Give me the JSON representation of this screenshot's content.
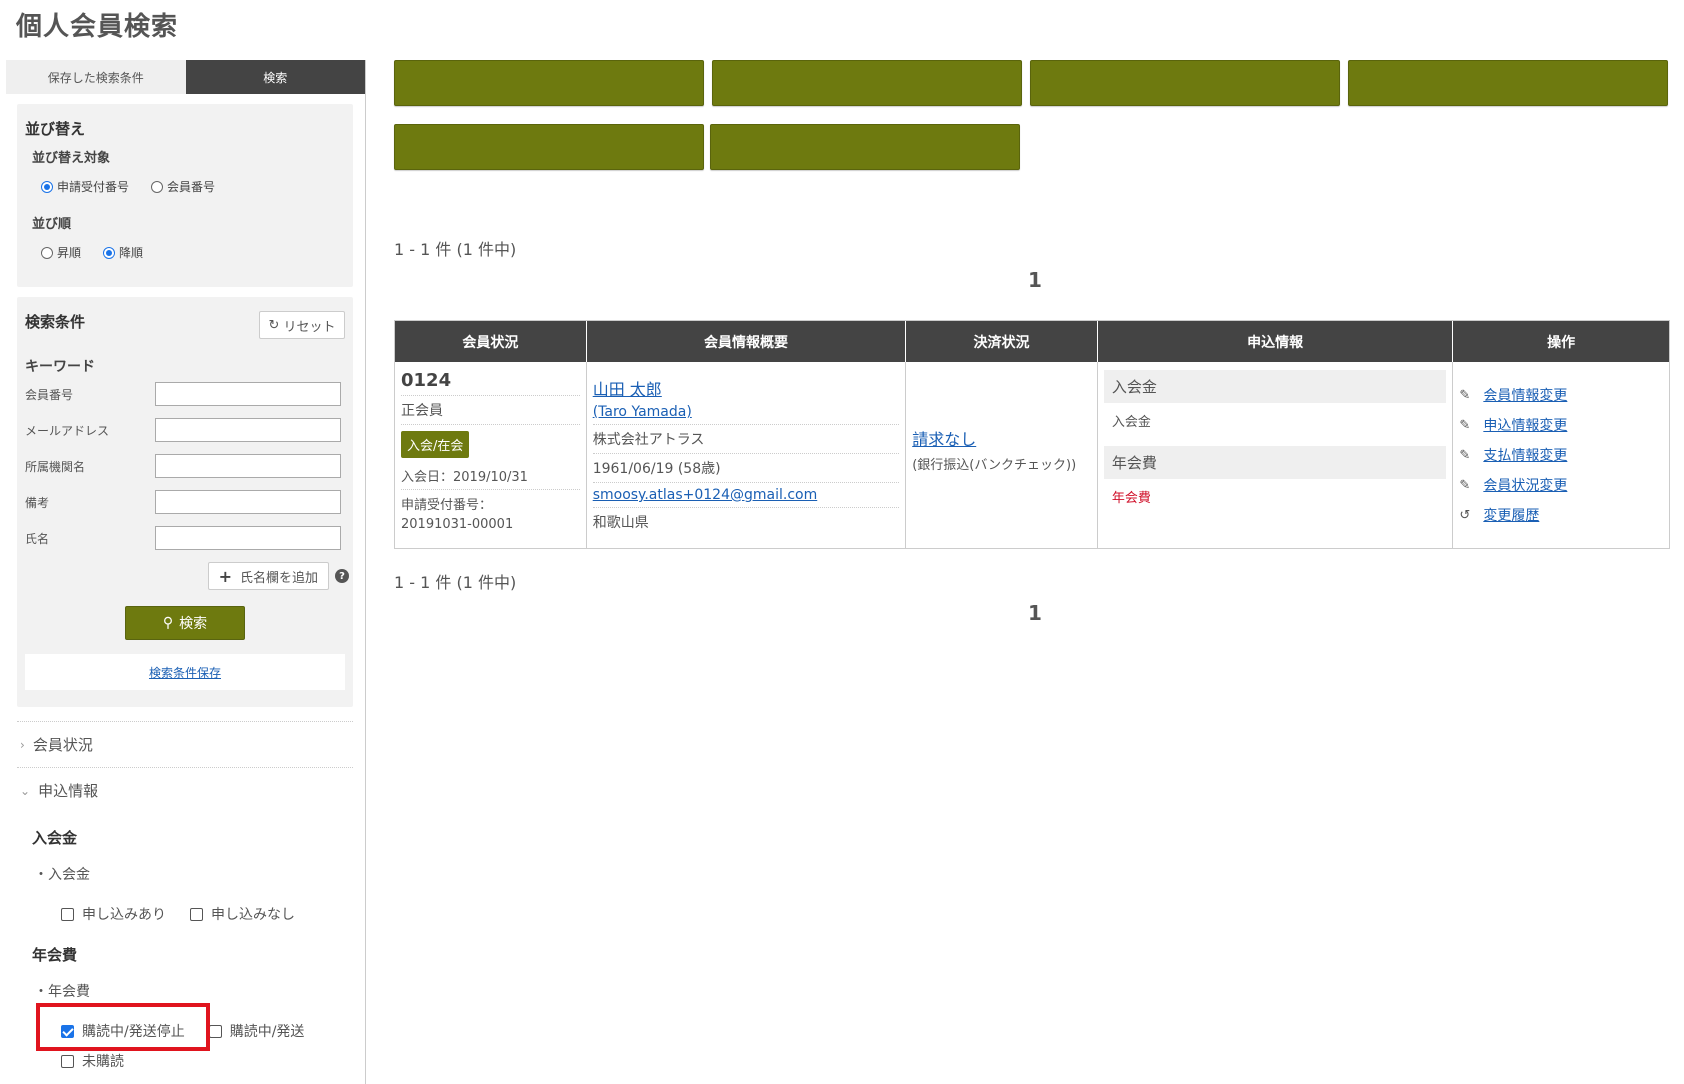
{
  "page": {
    "title": "個人会員検索"
  },
  "sidebar": {
    "tabs": [
      "保存した検索条件",
      "検索"
    ],
    "sort": {
      "title": "並び替え",
      "target_label": "並び替え対象",
      "target_options": [
        "申請受付番号",
        "会員番号"
      ],
      "order_label": "並び順",
      "order_options": [
        "昇順",
        "降順"
      ]
    },
    "conditions": {
      "title": "検索条件",
      "reset_label": "リセット",
      "keyword_label": "キーワード",
      "fields": [
        "会員番号",
        "メールアドレス",
        "所属機関名",
        "備考",
        "氏名"
      ],
      "add_name_label": "氏名欄を追加",
      "search_label": "検索",
      "save_link": "検索条件保存"
    },
    "accordions": {
      "member_status": "会員状況",
      "application": "申込情報"
    },
    "groups": {
      "entry_fee": {
        "title": "入会金",
        "bullet": "・入会金",
        "options": [
          "申し込みあり",
          "申し込みなし"
        ]
      },
      "annual_fee": {
        "title": "年会費",
        "bullet": "・年会費",
        "options": [
          "購読中/発送停止",
          "購読中/発送",
          "未購読"
        ]
      }
    }
  },
  "main": {
    "count_text": "1 - 1 件 (1 件中)",
    "page_number": "1",
    "table": {
      "headers": [
        "会員状況",
        "会員情報概要",
        "決済状況",
        "申込情報",
        "操作"
      ],
      "row": {
        "member_no": "0124",
        "member_type": "正会員",
        "status_badge": "入会/在会",
        "join_date": "入会日：2019/10/31",
        "app_no_label": "申請受付番号：",
        "app_no": "20191031-00001",
        "name": "山田 太郎",
        "name_en": "(Taro Yamada)",
        "company": "株式会社アトラス",
        "birth": "1961/06/19 (58歳)",
        "email": "smoosy.atlas+0124@gmail.com",
        "prefecture": "和歌山県",
        "payment_link": "請求なし",
        "payment_method": "(銀行振込(バンクチェック))",
        "entry_fee_header": "入会金",
        "entry_fee_value": "入会金",
        "annual_fee_header": "年会費",
        "annual_fee_value": "年会費",
        "ops": [
          "会員情報変更",
          "申込情報変更",
          "支払情報変更",
          "会員状況変更",
          "変更履歴"
        ]
      }
    }
  }
}
